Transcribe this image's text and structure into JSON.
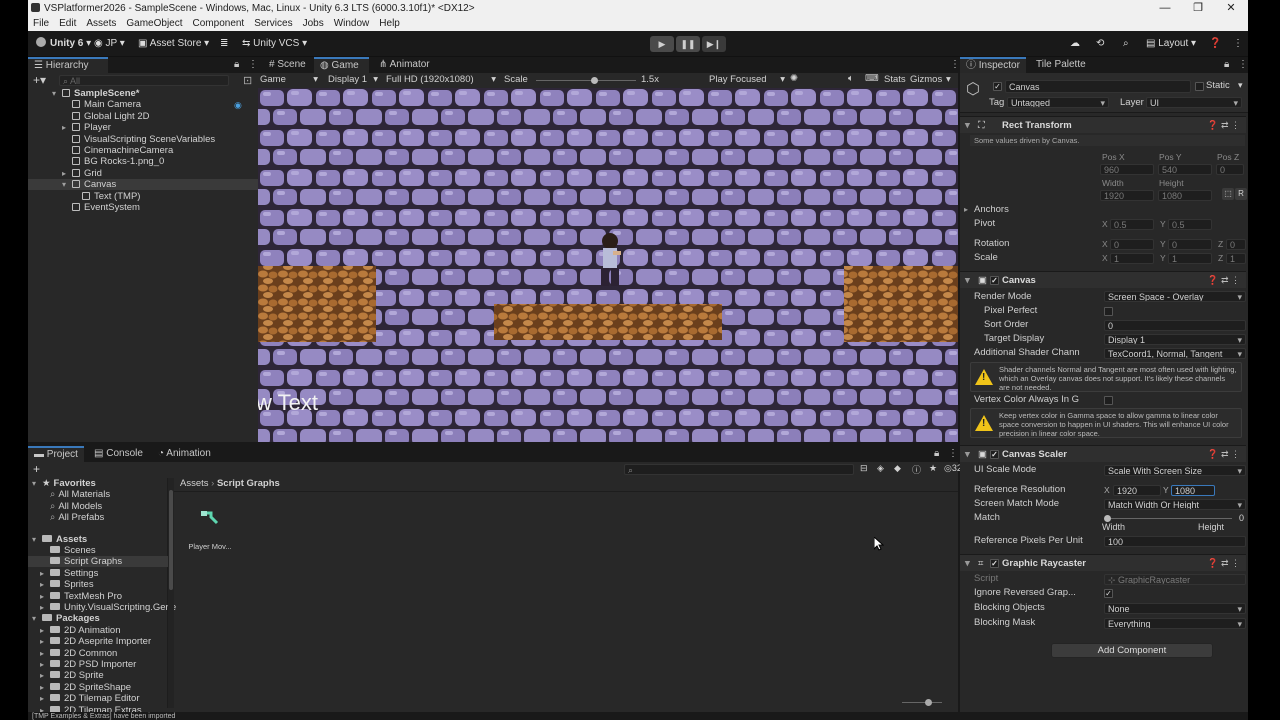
{
  "window": {
    "title": "VSPlatformer2026 - SampleScene - Windows, Mac, Linux - Unity 6.3 LTS (6000.3.10f1)* <DX12>",
    "minimize": "—",
    "maximize": "❐",
    "close": "✕"
  },
  "menu": [
    "File",
    "Edit",
    "Assets",
    "GameObject",
    "Component",
    "Services",
    "Jobs",
    "Window",
    "Help"
  ],
  "toolbar": {
    "unity": "Unity 6",
    "account": "JP",
    "asset_store": "Asset Store",
    "vcs": "Unity VCS",
    "layout": "Layout"
  },
  "hierarchy": {
    "tab": "Hierarchy",
    "search_placeholder": "All",
    "items": [
      {
        "label": "SampleScene*",
        "depth": 0,
        "fold": "▾",
        "kind": "scene",
        "selected": false
      },
      {
        "label": "Main Camera",
        "depth": 1,
        "fold": "",
        "kind": "go",
        "selected": false
      },
      {
        "label": "Global Light 2D",
        "depth": 1,
        "fold": "",
        "kind": "go",
        "selected": false
      },
      {
        "label": "Player",
        "depth": 1,
        "fold": "▸",
        "kind": "go",
        "selected": false
      },
      {
        "label": "VisualScripting SceneVariables",
        "depth": 1,
        "fold": "",
        "kind": "go",
        "selected": false
      },
      {
        "label": "CinemachineCamera",
        "depth": 1,
        "fold": "",
        "kind": "go",
        "selected": false
      },
      {
        "label": "BG Rocks-1.png_0",
        "depth": 1,
        "fold": "",
        "kind": "go",
        "selected": false
      },
      {
        "label": "Grid",
        "depth": 1,
        "fold": "▸",
        "kind": "go",
        "selected": false
      },
      {
        "label": "Canvas",
        "depth": 1,
        "fold": "▾",
        "kind": "go",
        "selected": true
      },
      {
        "label": "Text (TMP)",
        "depth": 2,
        "fold": "",
        "kind": "go",
        "selected": false
      },
      {
        "label": "EventSystem",
        "depth": 1,
        "fold": "",
        "kind": "go",
        "selected": false
      }
    ]
  },
  "game_tabs": {
    "scene": "Scene",
    "game": "Game",
    "animator": "Animator"
  },
  "game_toolbar": {
    "mode": "Game",
    "display": "Display 1",
    "resolution": "Full HD (1920x1080)",
    "scale_label": "Scale",
    "scale_value": "1.5x",
    "play_focused": "Play Focused",
    "stats": "Stats",
    "gizmos": "Gizmos"
  },
  "game_view": {
    "overlay_text": "w Text",
    "bg_color": "#8a7db8"
  },
  "project": {
    "tabs": {
      "project": "Project",
      "console": "Console",
      "animation": "Animation"
    },
    "item_count": "32",
    "breadcrumb": [
      "Assets",
      "Script Graphs"
    ],
    "tree": [
      {
        "label": "Favorites",
        "level": 0,
        "kind": "star",
        "bold": true,
        "fold": "▾"
      },
      {
        "label": "All Materials",
        "level": 1,
        "kind": "search",
        "bold": false,
        "fold": ""
      },
      {
        "label": "All Models",
        "level": 1,
        "kind": "search",
        "bold": false,
        "fold": ""
      },
      {
        "label": "All Prefabs",
        "level": 1,
        "kind": "search",
        "bold": false,
        "fold": ""
      },
      {
        "label": "",
        "level": 0,
        "kind": "gap",
        "bold": false,
        "fold": ""
      },
      {
        "label": "Assets",
        "level": 0,
        "kind": "folder",
        "bold": true,
        "fold": "▾"
      },
      {
        "label": "Scenes",
        "level": 1,
        "kind": "folder",
        "bold": false,
        "fold": ""
      },
      {
        "label": "Script Graphs",
        "level": 1,
        "kind": "folder",
        "bold": false,
        "fold": "",
        "selected": true
      },
      {
        "label": "Settings",
        "level": 1,
        "kind": "folder",
        "bold": false,
        "fold": "▸"
      },
      {
        "label": "Sprites",
        "level": 1,
        "kind": "folder",
        "bold": false,
        "fold": "▸"
      },
      {
        "label": "TextMesh Pro",
        "level": 1,
        "kind": "folder",
        "bold": false,
        "fold": "▸"
      },
      {
        "label": "Unity.VisualScripting.Gene",
        "level": 1,
        "kind": "folder",
        "bold": false,
        "fold": "▸"
      },
      {
        "label": "Packages",
        "level": 0,
        "kind": "folder",
        "bold": true,
        "fold": "▾"
      },
      {
        "label": "2D Animation",
        "level": 1,
        "kind": "folder",
        "bold": false,
        "fold": "▸"
      },
      {
        "label": "2D Aseprite Importer",
        "level": 1,
        "kind": "folder",
        "bold": false,
        "fold": "▸"
      },
      {
        "label": "2D Common",
        "level": 1,
        "kind": "folder",
        "bold": false,
        "fold": "▸"
      },
      {
        "label": "2D PSD Importer",
        "level": 1,
        "kind": "folder",
        "bold": false,
        "fold": "▸"
      },
      {
        "label": "2D Sprite",
        "level": 1,
        "kind": "folder",
        "bold": false,
        "fold": "▸"
      },
      {
        "label": "2D SpriteShape",
        "level": 1,
        "kind": "folder",
        "bold": false,
        "fold": "▸"
      },
      {
        "label": "2D Tilemap Editor",
        "level": 1,
        "kind": "folder",
        "bold": false,
        "fold": "▸"
      },
      {
        "label": "2D Tilemap Extras",
        "level": 1,
        "kind": "folder",
        "bold": false,
        "fold": "▸"
      }
    ],
    "asset": {
      "label": "Player Mov..."
    }
  },
  "status": {
    "message": "[TMP Examples & Extras] have been imported"
  },
  "inspector": {
    "tabs": {
      "inspector": "Inspector",
      "tile_palette": "Tile Palette"
    },
    "object": {
      "name": "Canvas",
      "static": "Static",
      "tag_label": "Tag",
      "tag": "Untagged",
      "layer_label": "Layer",
      "layer": "UI"
    },
    "rect": {
      "title": "Rect Transform",
      "note": "Some values driven by Canvas.",
      "posx_l": "Pos X",
      "posy_l": "Pos Y",
      "posz_l": "Pos Z",
      "posx": "960",
      "posy": "540",
      "posz": "0",
      "w_l": "Width",
      "h_l": "Height",
      "w": "1920",
      "h": "1080",
      "r_btn": "R",
      "anchors": "Anchors",
      "pivot": "Pivot",
      "pivot_x": "0.5",
      "pivot_y": "0.5",
      "rotation": "Rotation",
      "rot_x": "0",
      "rot_y": "0",
      "rot_z": "0",
      "scale": "Scale",
      "sc_x": "1",
      "sc_y": "1",
      "sc_z": "1",
      "xl": "X",
      "yl": "Y",
      "zl": "Z"
    },
    "canvas": {
      "title": "Canvas",
      "render_mode_l": "Render Mode",
      "render_mode": "Screen Space - Overlay",
      "pixel_perfect_l": "Pixel Perfect",
      "sort_order_l": "Sort Order",
      "sort_order": "0",
      "target_display_l": "Target Display",
      "target_display": "Display 1",
      "shader_ch_l": "Additional Shader Chann",
      "shader_ch": "TexCoord1, Normal, Tangent",
      "warn1": "Shader channels Normal and Tangent are most often used with lighting, which an Overlay canvas does not support. It's likely these channels are not needed.",
      "vertex_l": "Vertex Color Always In G",
      "warn2": "Keep vertex color in Gamma space to allow gamma to linear color space conversion to happen in UI shaders. This will enhance UI color precision in linear color space."
    },
    "scaler": {
      "title": "Canvas Scaler",
      "ui_scale_l": "UI Scale Mode",
      "ui_scale": "Scale With Screen Size",
      "ref_res_l": "Reference Resolution",
      "ref_x": "1920",
      "ref_y": "1080",
      "match_mode_l": "Screen Match Mode",
      "match_mode": "Match Width Or Height",
      "match_l": "Match",
      "match_val": "0",
      "width_l": "Width",
      "height_l": "Height",
      "ppu_l": "Reference Pixels Per Unit",
      "ppu": "100"
    },
    "raycaster": {
      "title": "Graphic Raycaster",
      "script_l": "Script",
      "script": "GraphicRaycaster",
      "ignore_l": "Ignore Reversed Grap...",
      "blocking_l": "Blocking Objects",
      "blocking": "None",
      "mask_l": "Blocking Mask",
      "mask": "Everything"
    },
    "add_component": "Add Component"
  }
}
